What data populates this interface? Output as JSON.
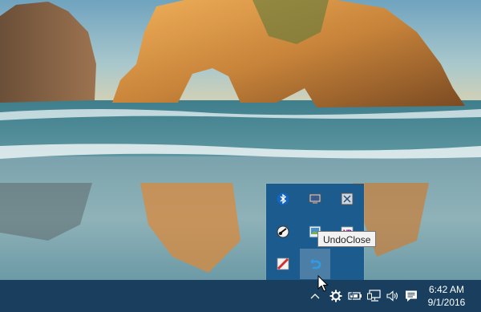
{
  "tooltip": {
    "text": "UndoClose"
  },
  "flyout": {
    "icons": [
      {
        "name": "bluetooth-icon"
      },
      {
        "name": "network-monitor-icon"
      },
      {
        "name": "window-app-icon"
      },
      {
        "name": "satellite-icon"
      },
      {
        "name": "photo-app-icon"
      },
      {
        "name": "notes-app-icon"
      },
      {
        "name": "blocked-app-icon"
      },
      {
        "name": "undo-close-icon"
      }
    ]
  },
  "taskbar": {
    "tray_icons": [
      "show-hidden-icons-chevron",
      "gear-icon",
      "battery-icon",
      "network-icon",
      "volume-icon",
      "action-center-icon"
    ],
    "clock": {
      "time": "6:42 AM",
      "date": "9/1/2016"
    }
  },
  "colors": {
    "taskbar": "#1a3f5e",
    "flyout": "#1b5b8e"
  }
}
